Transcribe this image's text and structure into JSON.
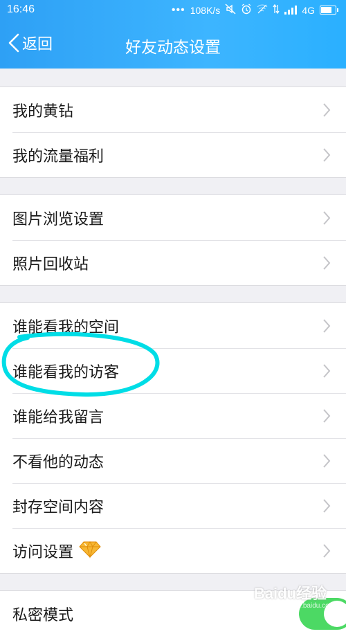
{
  "status": {
    "time": "16:46",
    "dots": "•••",
    "speed": "108K/s",
    "network": "4G",
    "icons": [
      "mute-icon",
      "alarm-icon",
      "wifi-off-icon",
      "data-arrows-icon",
      "signal-icon",
      "battery-icon"
    ]
  },
  "nav": {
    "back_label": "返回",
    "title": "好友动态设置"
  },
  "groups": [
    {
      "items": [
        {
          "label": "我的黄钻"
        },
        {
          "label": "我的流量福利"
        }
      ]
    },
    {
      "items": [
        {
          "label": "图片浏览设置"
        },
        {
          "label": "照片回收站"
        }
      ]
    },
    {
      "items": [
        {
          "label": "谁能看我的空间"
        },
        {
          "label": "谁能看我的访客",
          "highlighted": true
        },
        {
          "label": "谁能给我留言"
        },
        {
          "label": "不看他的动态"
        },
        {
          "label": "封存空间内容"
        },
        {
          "label": "访问设置",
          "badge_icon": "yellow-diamond-icon"
        }
      ]
    },
    {
      "items": [
        {
          "label": "私密模式",
          "toggle": true,
          "toggle_on": true
        }
      ]
    }
  ],
  "colors": {
    "header_start": "#2ea0f5",
    "header_end": "#3db5ff",
    "annotation_circle": "#00e0e8",
    "toggle_on": "#4cd964",
    "diamond": "#f5a623"
  },
  "watermark": {
    "text": "Baidu经验",
    "sub": "jingyan.baidu.com"
  }
}
